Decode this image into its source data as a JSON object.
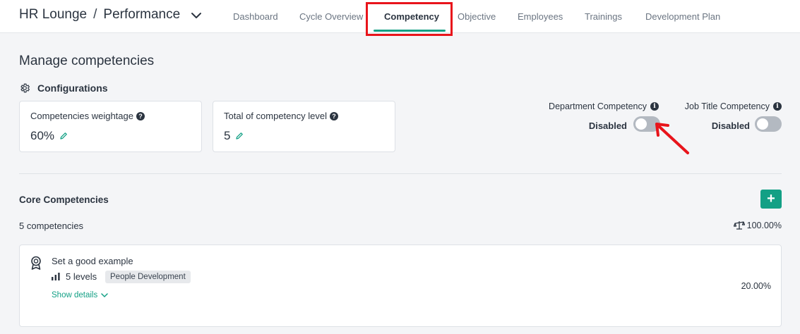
{
  "header": {
    "app_name": "HR Lounge",
    "separator": "/",
    "module": "Performance",
    "nav": [
      {
        "label": "Dashboard"
      },
      {
        "label": "Cycle Overview"
      },
      {
        "label": "Competency"
      },
      {
        "label": "Objective"
      },
      {
        "label": "Employees"
      },
      {
        "label": "Trainings"
      },
      {
        "label": "Development Plan"
      }
    ]
  },
  "main": {
    "page_title": "Manage competencies",
    "config_label": "Configurations",
    "cards": [
      {
        "label": "Competencies weightage",
        "value": "60%"
      },
      {
        "label": "Total of competency level",
        "value": "5"
      }
    ],
    "toggles": [
      {
        "label": "Department Competency",
        "state": "Disabled",
        "enabled": false
      },
      {
        "label": "Job Title Competency",
        "state": "Disabled",
        "enabled": false
      }
    ],
    "core": {
      "title": "Core Competencies",
      "add_label": "+",
      "count_text": "5 competencies",
      "total_weight": "100.00%",
      "items": [
        {
          "title": "Set a good example",
          "levels": "5 levels",
          "tag": "People Development",
          "details_label": "Show details",
          "weight": "20.00%"
        }
      ]
    }
  },
  "colors": {
    "accent": "#13a085",
    "highlight": "#e8141b",
    "toggle_off": "#b3b9c1"
  }
}
